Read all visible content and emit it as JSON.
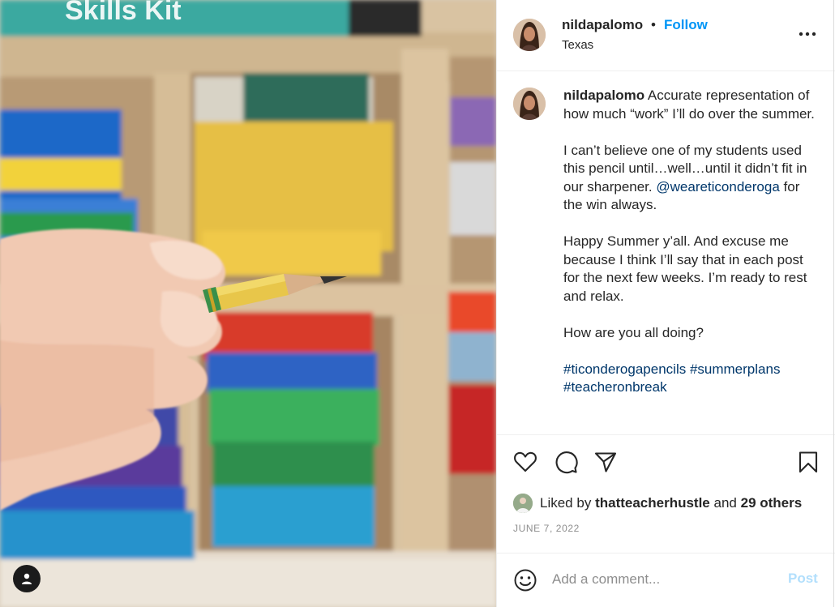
{
  "post": {
    "username": "nildapalomo",
    "separator": "•",
    "follow_label": "Follow",
    "location": "Texas",
    "more_icon": "more-horizontal-icon"
  },
  "caption": {
    "username": "nildapalomo",
    "line1": "Accurate representation of how much “work” I’ll do over the summer.",
    "line2_text": "I can’t believe one of my students used this pencil until…well…until it didn’t fit in our sharpener.",
    "mention": "@weareticonderoga",
    "line2_tail": "for the win always.",
    "line3": "Happy Summer y’all. And excuse me because I think I’ll say that in each post for the next few weeks. I’m ready to rest and relax.",
    "line4": "How are you all doing?",
    "hashtags": [
      "#ticonderogapencils",
      "#summerplans",
      "#teacheronbreak"
    ]
  },
  "actions": {
    "icons": [
      "heart-icon",
      "comment-icon",
      "share-icon",
      "bookmark-icon"
    ]
  },
  "likes": {
    "prefix": "Liked by",
    "user": "thatteacherhustle",
    "joiner": "and",
    "others": "29 others"
  },
  "date": "JUNE 7, 2022",
  "comment": {
    "placeholder": "Add a comment...",
    "post_label": "Post"
  },
  "colors": {
    "link_blue": "#0095f6",
    "mention_blue": "#00376b",
    "post_disabled": "#b2dffc",
    "muted": "#8e8e8e"
  }
}
